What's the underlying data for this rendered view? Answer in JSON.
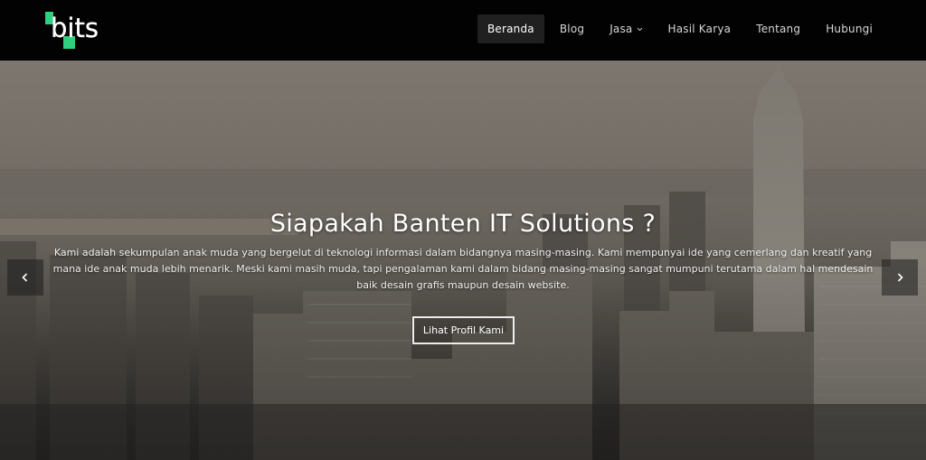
{
  "brand": {
    "logo_text": "bits",
    "accent_color": "#2fcf7f"
  },
  "nav": {
    "items": [
      {
        "label": "Beranda",
        "active": true
      },
      {
        "label": "Blog",
        "active": false
      },
      {
        "label": "Jasa",
        "active": false,
        "dropdown": true
      },
      {
        "label": "Hasil Karya",
        "active": false
      },
      {
        "label": "Tentang",
        "active": false
      },
      {
        "label": "Hubungi",
        "active": false
      }
    ]
  },
  "hero": {
    "title": "Siapakah Banten IT Solutions ?",
    "description": "Kami adalah sekumpulan anak muda yang bergelut di teknologi informasi dalam bidangnya masing-masing. Kami mempunyai ide yang cemerlang dan kreatif yang mana ide anak muda lebih menarik. Meski kami masih muda, tapi pengalaman kami dalam bidang masing-masing sangat mumpuni terutama dalam hal mendesain baik desain grafis maupun desain website.",
    "button_label": "Lihat Profil Kami",
    "prev_icon": "chevron-left-icon",
    "next_icon": "chevron-right-icon"
  }
}
